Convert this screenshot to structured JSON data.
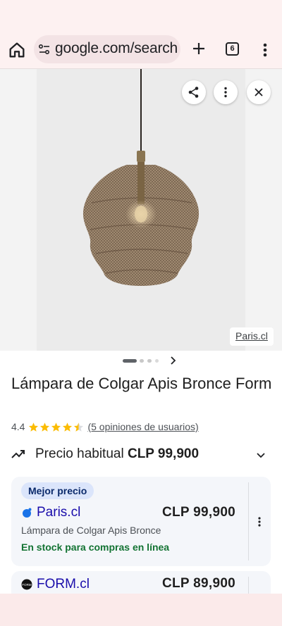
{
  "browser": {
    "url": "google.com/search",
    "tab_count": "6",
    "icons": {
      "home": "home-icon",
      "site_info": "tune-icon",
      "new_tab": "plus-icon",
      "menu": "more-vert-icon"
    }
  },
  "viewer": {
    "source_label": "Paris.cl",
    "carousel_pages": 4,
    "carousel_active": 0,
    "actions": [
      "share-icon",
      "more-vert-icon",
      "close-icon"
    ]
  },
  "product": {
    "title": "Lámpara de Colgar Apis Bronce Form",
    "rating": "4.4",
    "stars": 4.5,
    "reviews": "(5 opiniones de usuarios)",
    "price_label": "Precio habitual",
    "price_value": "CLP 99,900"
  },
  "offers": [
    {
      "badge": "Mejor precio",
      "store": "Paris.cl",
      "price": "CLP 99,900",
      "description": "Lámpara de Colgar Apis Bronce",
      "stock": "En stock para compras en línea",
      "logo_color": "#1a73e8"
    },
    {
      "store": "FORM.cl",
      "price": "CLP 89,900",
      "logo_text": "FORM"
    }
  ],
  "colors": {
    "link": "#1a0dab",
    "stock": "#137333",
    "star": "#fbbc04",
    "badge_bg": "#dbe5fb"
  }
}
